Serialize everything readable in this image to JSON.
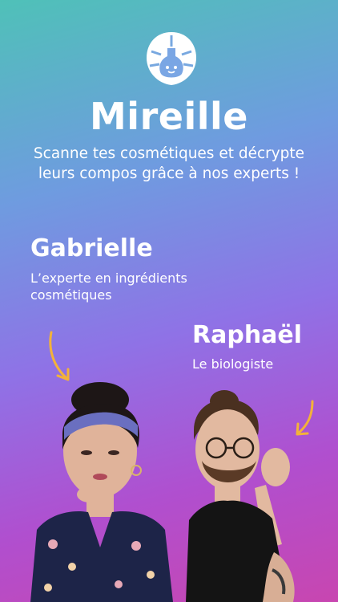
{
  "app": {
    "title": "Mireille",
    "tagline": "Scanne tes cosmétiques et décrypte leurs compos grâce à nos experts !",
    "logo_icon": "monstera-leaf-flask-icon"
  },
  "experts": [
    {
      "name": "Gabrielle",
      "role": "L’experte en ingrédients cosmétiques",
      "photo": "gabrielle-photo"
    },
    {
      "name": "Raphaël",
      "role": "Le biologiste",
      "photo": "raphael-photo"
    }
  ],
  "colors": {
    "gradient_top": "#4fc1b8",
    "gradient_mid": "#8f72e6",
    "gradient_bottom": "#c846b0",
    "arrow": "#f3b23a",
    "text": "#ffffff"
  }
}
